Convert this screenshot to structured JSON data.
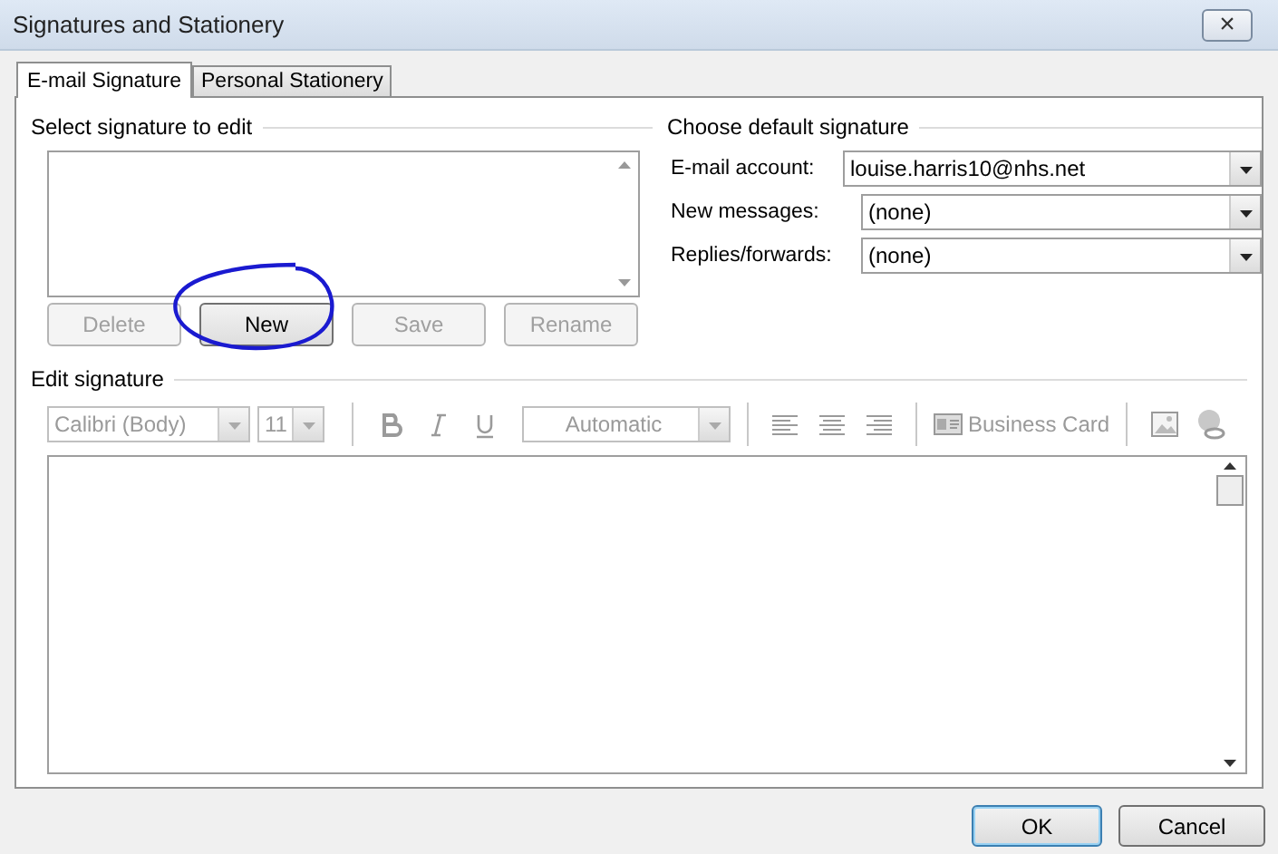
{
  "window": {
    "title": "Signatures and Stationery",
    "close_glyph": "×"
  },
  "tabs": [
    {
      "label": "E-mail Signature",
      "selected": true
    },
    {
      "label": "Personal Stationery",
      "selected": false
    }
  ],
  "select_signature": {
    "heading": "Select signature to edit",
    "buttons": [
      {
        "label": "Delete",
        "disabled": true
      },
      {
        "label": "New",
        "disabled": false
      },
      {
        "label": "Save",
        "disabled": true
      },
      {
        "label": "Rename",
        "disabled": true
      }
    ]
  },
  "default_signature": {
    "heading": "Choose default signature",
    "fields": [
      {
        "label": "E-mail account:",
        "value": "louise.harris10@nhs.net"
      },
      {
        "label": "New messages:",
        "value": "(none)"
      },
      {
        "label": "Replies/forwards:",
        "value": "(none)"
      }
    ]
  },
  "edit_signature": {
    "heading": "Edit signature",
    "toolbar": [
      {
        "kind": "combo",
        "value": "Calibri (Body)",
        "disabled": true
      },
      {
        "kind": "combo",
        "value": "11",
        "disabled": true
      },
      {
        "kind": "sep"
      },
      {
        "kind": "bold",
        "disabled": true
      },
      {
        "kind": "italic",
        "disabled": true
      },
      {
        "kind": "underline",
        "disabled": true
      },
      {
        "kind": "color",
        "value": "Automatic",
        "disabled": true
      },
      {
        "kind": "sep"
      },
      {
        "kind": "align-left",
        "disabled": true
      },
      {
        "kind": "align-center",
        "disabled": true
      },
      {
        "kind": "align-right",
        "disabled": true
      },
      {
        "kind": "sep"
      },
      {
        "kind": "card",
        "label": "Business Card",
        "disabled": true
      },
      {
        "kind": "sep"
      },
      {
        "kind": "picture",
        "disabled": true
      },
      {
        "kind": "link",
        "disabled": true
      }
    ]
  },
  "buttons": [
    {
      "label": "OK",
      "default": true
    },
    {
      "label": "Cancel",
      "default": false
    }
  ]
}
